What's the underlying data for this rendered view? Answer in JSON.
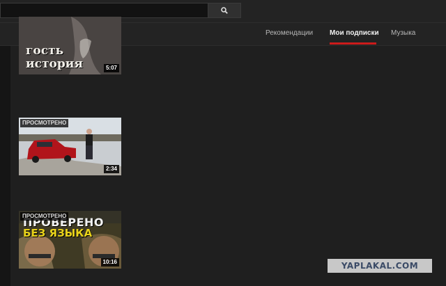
{
  "search": {
    "placeholder": "",
    "value": ""
  },
  "tabs": [
    {
      "label": "Рекомендации"
    },
    {
      "label": "Мои подписки"
    },
    {
      "label": "Музыка"
    }
  ],
  "videos": [
    {
      "duration": "5:07",
      "overlay_lines": [
        "гость",
        "история"
      ]
    },
    {
      "duration": "2:34",
      "badge": "ПРОСМОТРЕНО"
    },
    {
      "duration": "10:16",
      "badge": "ПРОСМОТРЕНО",
      "overlay_lines": [
        "ПРОВЕРЕНО",
        "БЕЗ ЯЗЫКА"
      ]
    }
  ],
  "watermark": {
    "text": "YAPLAKAL.COM"
  },
  "colors": {
    "accent": "#cc1b1b",
    "background": "#1f1f1f",
    "yellow_text": "#e8d21a"
  }
}
